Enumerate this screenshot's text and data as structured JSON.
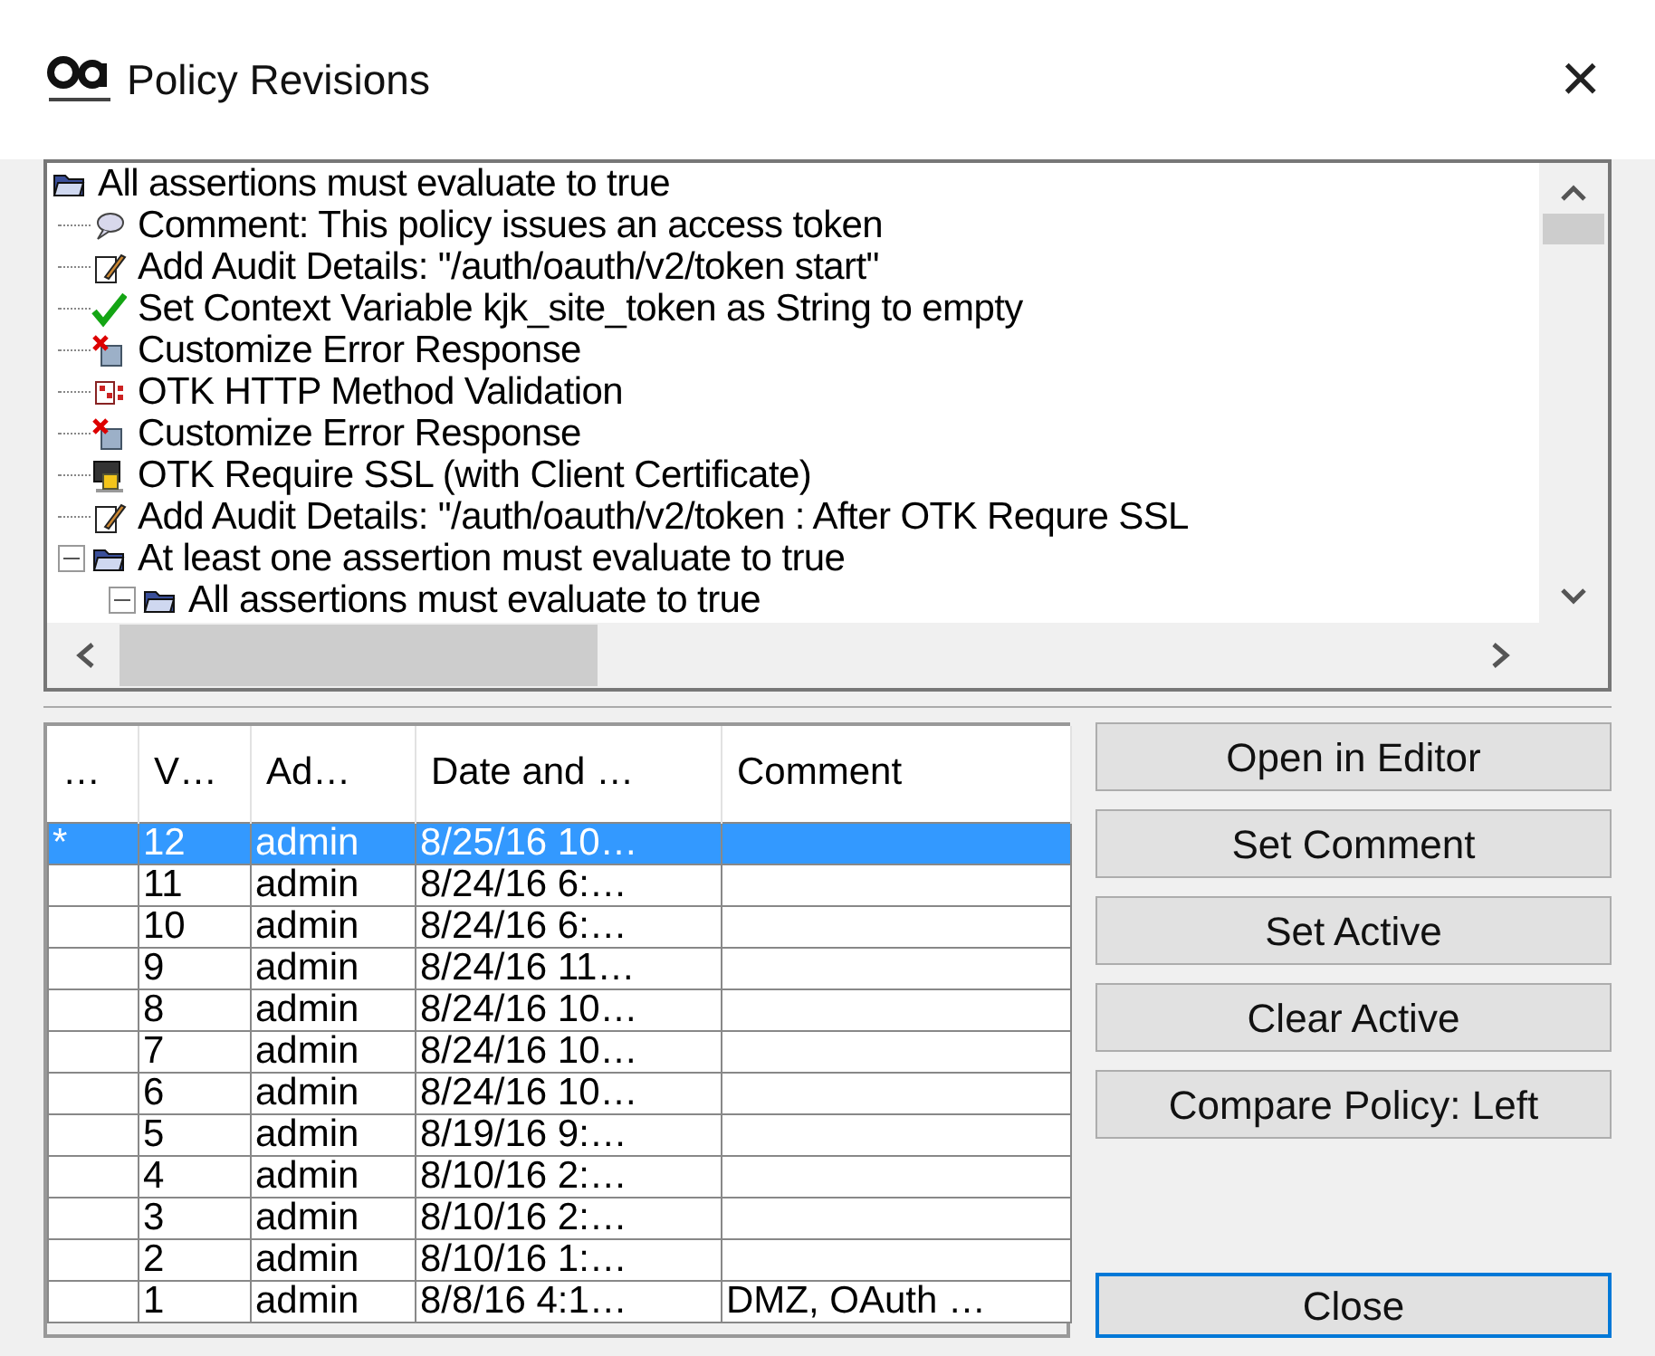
{
  "window": {
    "title": "Policy Revisions",
    "close": "×"
  },
  "tree": [
    {
      "kind": "folder",
      "label": "All assertions must evaluate to true",
      "children": [
        {
          "kind": "comment",
          "label": "Comment: This policy issues an access token"
        },
        {
          "kind": "audit",
          "label": "Add Audit Details: \"/auth/oauth/v2/token start\""
        },
        {
          "kind": "check",
          "label": "Set Context Variable kjk_site_token as String to empty"
        },
        {
          "kind": "error",
          "label": "Customize Error Response"
        },
        {
          "kind": "method",
          "label": "OTK HTTP Method Validation"
        },
        {
          "kind": "error",
          "label": "Customize Error Response"
        },
        {
          "kind": "ssl",
          "label": "OTK Require SSL (with Client Certificate)"
        },
        {
          "kind": "audit",
          "label": "Add Audit Details: \"/auth/oauth/v2/token : After OTK Requre SSL"
        },
        {
          "kind": "folder",
          "label": "At least one assertion must evaluate to true",
          "expanded": true,
          "children": [
            {
              "kind": "folder",
              "label": "All assertions must evaluate to true",
              "expanded": true
            }
          ]
        }
      ]
    }
  ],
  "table": {
    "columns": [
      "…",
      "V…",
      "Ad…",
      "Date and …",
      "Comment"
    ],
    "rows": [
      {
        "cells": [
          "*",
          "12",
          "admin",
          "8/25/16 10…",
          ""
        ],
        "selected": true
      },
      {
        "cells": [
          "",
          "11",
          "admin",
          "8/24/16 6:…",
          ""
        ],
        "selected": false
      },
      {
        "cells": [
          "",
          "10",
          "admin",
          "8/24/16 6:…",
          ""
        ],
        "selected": false
      },
      {
        "cells": [
          "",
          "9",
          "admin",
          "8/24/16 11…",
          ""
        ],
        "selected": false
      },
      {
        "cells": [
          "",
          "8",
          "admin",
          "8/24/16 10…",
          ""
        ],
        "selected": false
      },
      {
        "cells": [
          "",
          "7",
          "admin",
          "8/24/16 10…",
          ""
        ],
        "selected": false
      },
      {
        "cells": [
          "",
          "6",
          "admin",
          "8/24/16 10…",
          ""
        ],
        "selected": false
      },
      {
        "cells": [
          "",
          "5",
          "admin",
          "8/19/16 9:…",
          ""
        ],
        "selected": false
      },
      {
        "cells": [
          "",
          "4",
          "admin",
          "8/10/16 2:…",
          ""
        ],
        "selected": false
      },
      {
        "cells": [
          "",
          "3",
          "admin",
          "8/10/16 2:…",
          ""
        ],
        "selected": false
      },
      {
        "cells": [
          "",
          "2",
          "admin",
          "8/10/16 1:…",
          ""
        ],
        "selected": false
      },
      {
        "cells": [
          "",
          "1",
          "admin",
          "8/8/16 4:1…",
          "DMZ, OAuth …"
        ],
        "selected": false
      }
    ]
  },
  "buttons": [
    {
      "label": "Open in Editor",
      "focused": false
    },
    {
      "label": "Set Comment",
      "focused": false
    },
    {
      "label": "Set Active",
      "focused": false
    },
    {
      "label": "Clear Active",
      "focused": false
    },
    {
      "label": "Compare Policy: Left",
      "focused": false
    }
  ],
  "close_button": {
    "label": "Close",
    "focused": true
  }
}
